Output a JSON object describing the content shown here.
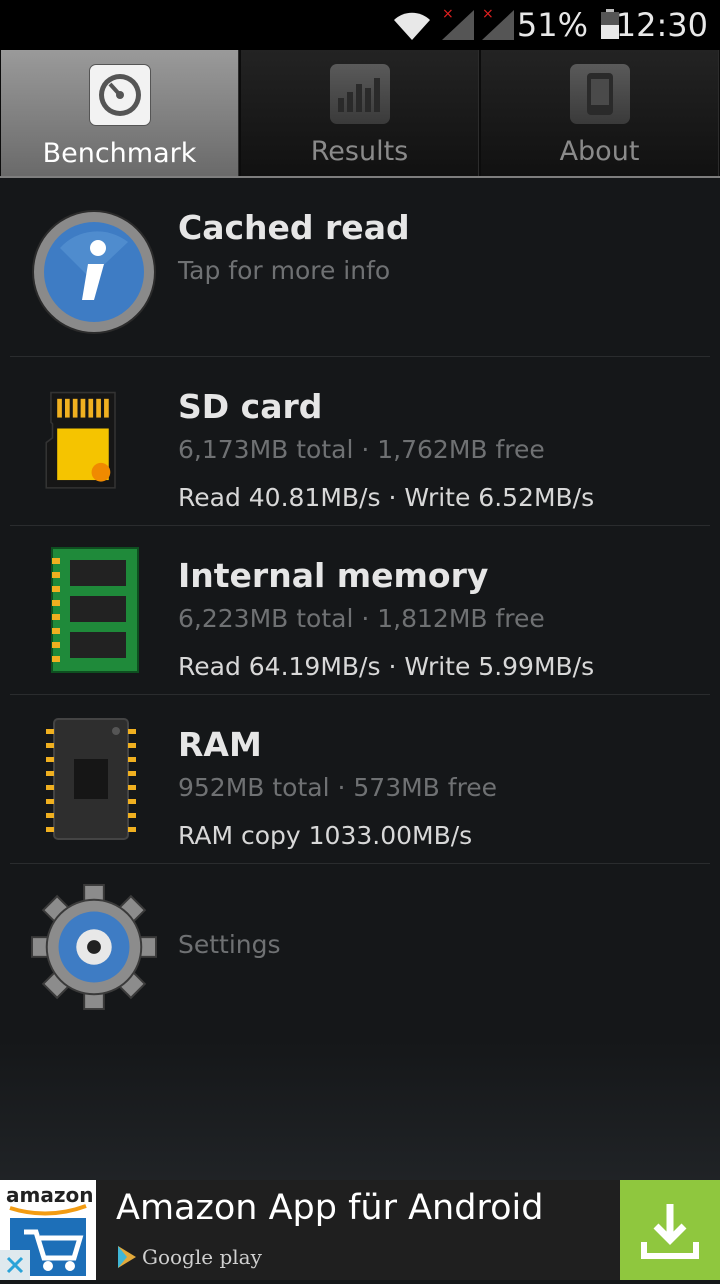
{
  "status_bar": {
    "time": "12:30",
    "battery_percent": "51%",
    "icons": [
      "wifi-icon",
      "signal-icon",
      "signal-icon",
      "battery-icon"
    ]
  },
  "tabs": [
    {
      "label": "Benchmark",
      "icon": "speedometer-icon",
      "active": true
    },
    {
      "label": "Results",
      "icon": "bar-chart-icon",
      "active": false
    },
    {
      "label": "About",
      "icon": "phone-icon",
      "active": false
    }
  ],
  "items": {
    "cached": {
      "title": "Cached read",
      "subtitle": "Tap for more info",
      "icon": "info-icon"
    },
    "sd": {
      "title": "SD card",
      "subtitle": "6,173MB total · 1,762MB free",
      "speed": "Read 40.81MB/s · Write 6.52MB/s",
      "icon": "sd-card-icon"
    },
    "internal": {
      "title": "Internal memory",
      "subtitle": "6,223MB total · 1,812MB free",
      "speed": "Read 64.19MB/s · Write 5.99MB/s",
      "icon": "memory-chip-icon"
    },
    "ram": {
      "title": "RAM",
      "subtitle": "952MB total · 573MB free",
      "speed": "RAM copy 1033.00MB/s",
      "icon": "ram-chip-icon"
    }
  },
  "settings": {
    "label": "Settings",
    "icon": "gear-icon"
  },
  "ad": {
    "logo_text": "amazon",
    "title": "Amazon App für Android",
    "store_label": "Google play",
    "download_icon": "download-icon",
    "close_icon": "close-icon",
    "button_color": "#8fc73e"
  }
}
